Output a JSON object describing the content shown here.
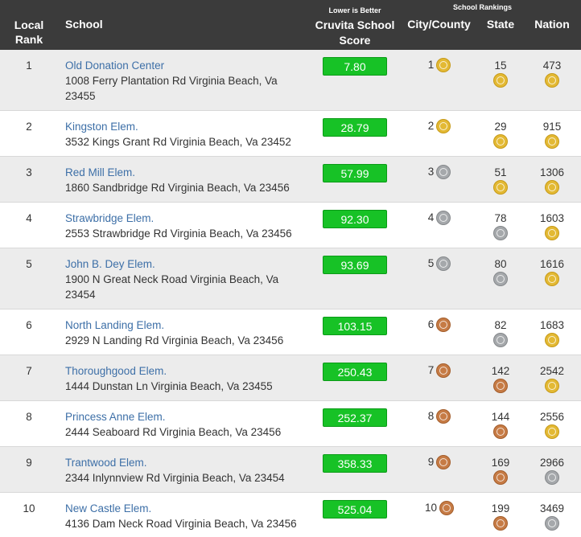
{
  "header": {
    "local_rank": "Local Rank",
    "school": "School",
    "score_caption": "Lower is Better",
    "score": "Cruvita School Score",
    "rankings_caption": "School Rankings",
    "city_county": "City/County",
    "state": "State",
    "nation": "Nation"
  },
  "colors": {
    "header_bg": "#3b3b3b",
    "link": "#3d6fa7",
    "score_pill": "#17c226",
    "gold": "#e3b934",
    "silver": "#a5a8ab",
    "bronze": "#c67b45"
  },
  "rows": [
    {
      "rank": "1",
      "name": "Old Donation Center",
      "address": "1008 Ferry Plantation Rd Virginia Beach, Va 23455",
      "score": "7.80",
      "city": "1",
      "city_medal": "gold-medal-icon",
      "state": "15",
      "state_medal": "gold-medal-icon",
      "nation": "473",
      "nation_medal": "gold-medal-icon"
    },
    {
      "rank": "2",
      "name": "Kingston Elem.",
      "address": "3532 Kings Grant Rd Virginia Beach, Va 23452",
      "score": "28.79",
      "city": "2",
      "city_medal": "gold-medal-icon",
      "state": "29",
      "state_medal": "gold-medal-icon",
      "nation": "915",
      "nation_medal": "gold-medal-icon"
    },
    {
      "rank": "3",
      "name": "Red Mill Elem.",
      "address": "1860 Sandbridge Rd Virginia Beach, Va 23456",
      "score": "57.99",
      "city": "3",
      "city_medal": "silver-medal-icon",
      "state": "51",
      "state_medal": "gold-medal-icon",
      "nation": "1306",
      "nation_medal": "gold-medal-icon"
    },
    {
      "rank": "4",
      "name": "Strawbridge Elem.",
      "address": "2553 Strawbridge Rd Virginia Beach, Va 23456",
      "score": "92.30",
      "city": "4",
      "city_medal": "silver-medal-icon",
      "state": "78",
      "state_medal": "silver-medal-icon",
      "nation": "1603",
      "nation_medal": "gold-medal-icon"
    },
    {
      "rank": "5",
      "name": "John B. Dey Elem.",
      "address": "1900 N Great Neck Road Virginia Beach, Va 23454",
      "score": "93.69",
      "city": "5",
      "city_medal": "silver-medal-icon",
      "state": "80",
      "state_medal": "silver-medal-icon",
      "nation": "1616",
      "nation_medal": "gold-medal-icon"
    },
    {
      "rank": "6",
      "name": "North Landing Elem.",
      "address": "2929 N Landing Rd Virginia Beach, Va 23456",
      "score": "103.15",
      "city": "6",
      "city_medal": "bronze-medal-icon",
      "state": "82",
      "state_medal": "silver-medal-icon",
      "nation": "1683",
      "nation_medal": "gold-medal-icon"
    },
    {
      "rank": "7",
      "name": "Thoroughgood Elem.",
      "address": "1444 Dunstan Ln Virginia Beach, Va 23455",
      "score": "250.43",
      "city": "7",
      "city_medal": "bronze-medal-icon",
      "state": "142",
      "state_medal": "bronze-medal-icon",
      "nation": "2542",
      "nation_medal": "gold-medal-icon"
    },
    {
      "rank": "8",
      "name": "Princess Anne Elem.",
      "address": "2444 Seaboard Rd Virginia Beach, Va 23456",
      "score": "252.37",
      "city": "8",
      "city_medal": "bronze-medal-icon",
      "state": "144",
      "state_medal": "bronze-medal-icon",
      "nation": "2556",
      "nation_medal": "gold-medal-icon"
    },
    {
      "rank": "9",
      "name": "Trantwood Elem.",
      "address": "2344 Inlynnview Rd Virginia Beach, Va 23454",
      "score": "358.33",
      "city": "9",
      "city_medal": "bronze-medal-icon",
      "state": "169",
      "state_medal": "bronze-medal-icon",
      "nation": "2966",
      "nation_medal": "silver-medal-icon"
    },
    {
      "rank": "10",
      "name": "New Castle Elem.",
      "address": "4136 Dam Neck Road Virginia Beach, Va 23456",
      "score": "525.04",
      "city": "10",
      "city_medal": "bronze-medal-icon",
      "state": "199",
      "state_medal": "bronze-medal-icon",
      "nation": "3469",
      "nation_medal": "silver-medal-icon"
    }
  ]
}
